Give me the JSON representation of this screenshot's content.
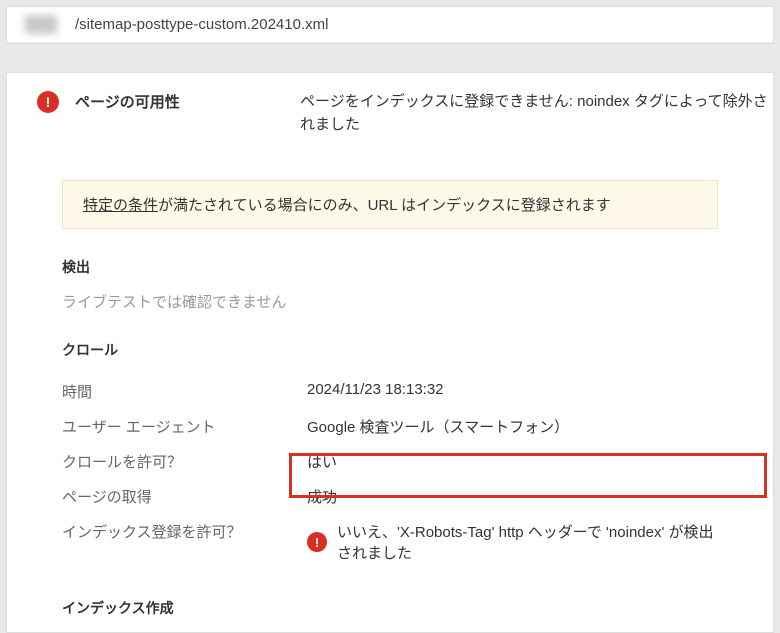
{
  "url": {
    "path": "/sitemap-posttype-custom.202410.xml"
  },
  "availability": {
    "label": "ページの可用性",
    "value": "ページをインデックスに登録できません: noindex タグによって除外されました"
  },
  "banner": {
    "link_text": "特定の条件",
    "rest": "が満たされている場合にのみ、URL はインデックスに登録されます"
  },
  "sections": {
    "detection": {
      "title": "検出",
      "note": "ライブテストでは確認できません"
    },
    "crawl": {
      "title": "クロール",
      "rows": [
        {
          "label": "時間",
          "value": "2024/11/23 18:13:32"
        },
        {
          "label": "ユーザー エージェント",
          "value": "Google 検査ツール（スマートフォン）"
        },
        {
          "label": "クロールを許可？",
          "value": "はい"
        },
        {
          "label": "ページの取得",
          "value": "成功"
        },
        {
          "label": "インデックス登録を許可？",
          "value": "いいえ、'X-Robots-Tag' http ヘッダーで 'noindex' が検出されました",
          "error": true
        }
      ]
    },
    "indexing": {
      "title": "インデックス作成"
    }
  }
}
